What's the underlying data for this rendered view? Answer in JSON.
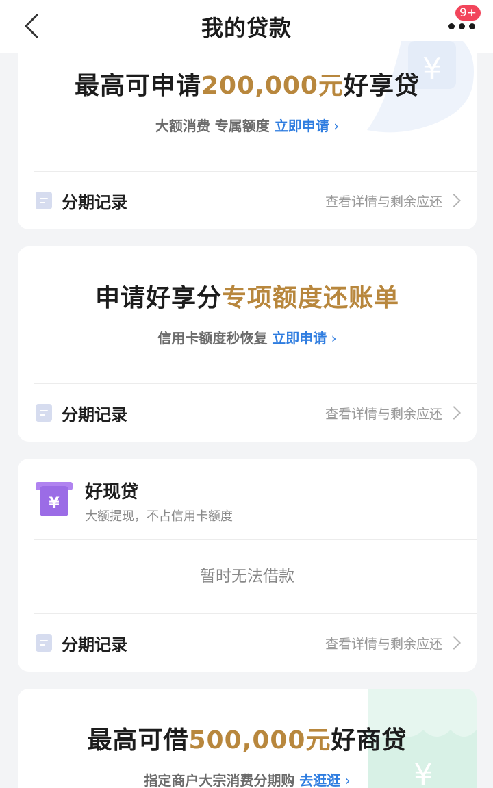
{
  "header": {
    "title": "我的贷款",
    "badge": "9+"
  },
  "card_haoxiang": {
    "title_pre": "最高可申请",
    "title_amount": "200,000元",
    "title_post": "好享贷",
    "sub_text": "大额消费 专属额度",
    "sub_link": "立即申请",
    "record_label": "分期记录",
    "record_detail": "查看详情与剩余应还"
  },
  "card_haoxiangfen": {
    "title_pre": "申请好享分",
    "title_highlight": "专项额度还账单",
    "sub_text": "信用卡额度秒恢复",
    "sub_link": "立即申请",
    "record_label": "分期记录",
    "record_detail": "查看详情与剩余应还"
  },
  "card_haoxian": {
    "title": "好现贷",
    "subtitle": "大额提现，不占信用卡额度",
    "status": "暂时无法借款",
    "record_label": "分期记录",
    "record_detail": "查看详情与剩余应还"
  },
  "card_haoshang": {
    "title_pre": "最高可借",
    "title_amount": "500,000元",
    "title_post": "好商贷",
    "sub_text": "指定商户大宗消费分期购",
    "sub_link": "去逛逛"
  },
  "colors": {
    "highlight": "#b8873d",
    "link": "#2f7de0",
    "badge": "#f2455b"
  }
}
